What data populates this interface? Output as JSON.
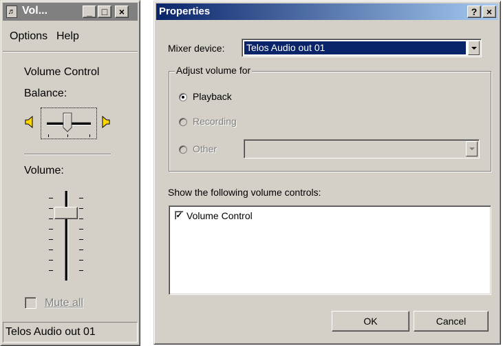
{
  "volume_window": {
    "title": "Vol...",
    "menu": [
      {
        "label": "Options"
      },
      {
        "label": "Help"
      }
    ],
    "control_name": "Volume Control",
    "balance_label": "Balance:",
    "volume_label": "Volume:",
    "volume_level_percent": 75,
    "balance_position": "center",
    "mute_label": "Mute all",
    "mute_checked": false,
    "status_bar": "Telos Audio out 01",
    "minimize_glyph": "_",
    "maximize_glyph": "□",
    "close_glyph": "×"
  },
  "properties_dialog": {
    "title": "Properties",
    "help_glyph": "?",
    "close_glyph": "×",
    "mixer_device_label": "Mixer device:",
    "mixer_device_value": "Telos Audio out 01",
    "adjust_group_label": "Adjust volume for",
    "radios": [
      {
        "label": "Playback",
        "selected": true,
        "enabled": true
      },
      {
        "label": "Recording",
        "selected": false,
        "enabled": false
      },
      {
        "label": "Other",
        "selected": false,
        "enabled": false
      }
    ],
    "other_select_value": "",
    "show_controls_label": "Show the following volume controls:",
    "controls_list": [
      {
        "label": "Volume Control",
        "checked": true
      }
    ],
    "ok_label": "OK",
    "cancel_label": "Cancel"
  },
  "colors": {
    "titlebar_active_start": "#0a246a",
    "titlebar_active_end": "#a6caf0",
    "titlebar_inactive": "#808080",
    "face": "#d4d0c8",
    "selection": "#0a246a"
  }
}
